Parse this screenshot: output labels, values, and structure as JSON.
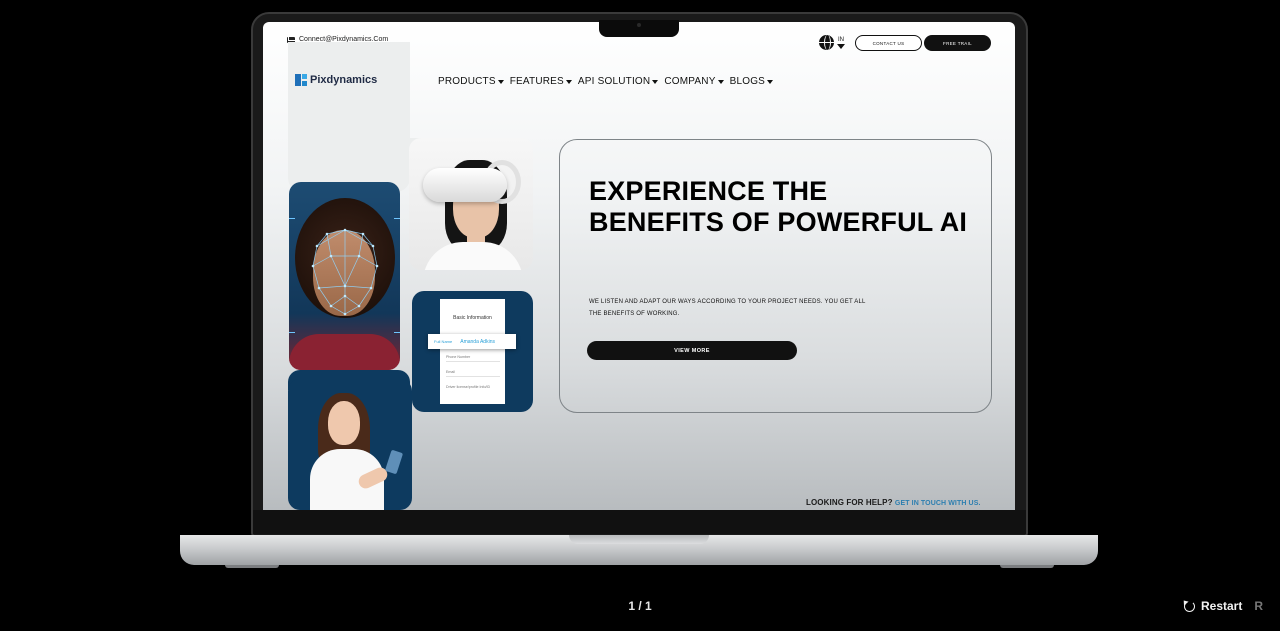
{
  "site": {
    "email": "Connect@Pixdynamics.Com",
    "lang": "IN",
    "contact_label": "CONTACT US",
    "trial_label": "FREE TRAIL",
    "logo_text": "Pixdynamics",
    "nav": [
      {
        "label": "PRODUCTS"
      },
      {
        "label": "FEATURES"
      },
      {
        "label": "API SOLUTION"
      },
      {
        "label": "COMPANY"
      },
      {
        "label": "BLOGS"
      }
    ],
    "form": {
      "title": "Basic Information",
      "full_name_label": "Full Name",
      "full_name_value": "Amanda Adkins",
      "phone_label": "Phone Number",
      "email_label": "Email",
      "upload_label": "Driver license/profile Info/ID"
    },
    "hero": {
      "title": "EXPERIENCE THE BENEFITS OF POWERFUL AI",
      "subtitle": "WE LISTEN AND ADAPT OUR WAYS ACCORDING TO YOUR PROJECT NEEDS. YOU GET ALL THE BENEFITS OF WORKING.",
      "button": "VIEW MORE"
    },
    "help": {
      "text": "LOOKING FOR HELP?",
      "link": "GET IN TOUCH WITH US."
    }
  },
  "viewer": {
    "pager": "1 / 1",
    "restart_label": "Restart",
    "restart_key": "R"
  },
  "colors": {
    "accent": "#2d7fb0",
    "dark_tile": "#0d3a5f",
    "button": "#111111"
  },
  "icons": [
    "mail-icon",
    "globe-icon",
    "caret-icon",
    "logo-icon",
    "restart-icon"
  ]
}
